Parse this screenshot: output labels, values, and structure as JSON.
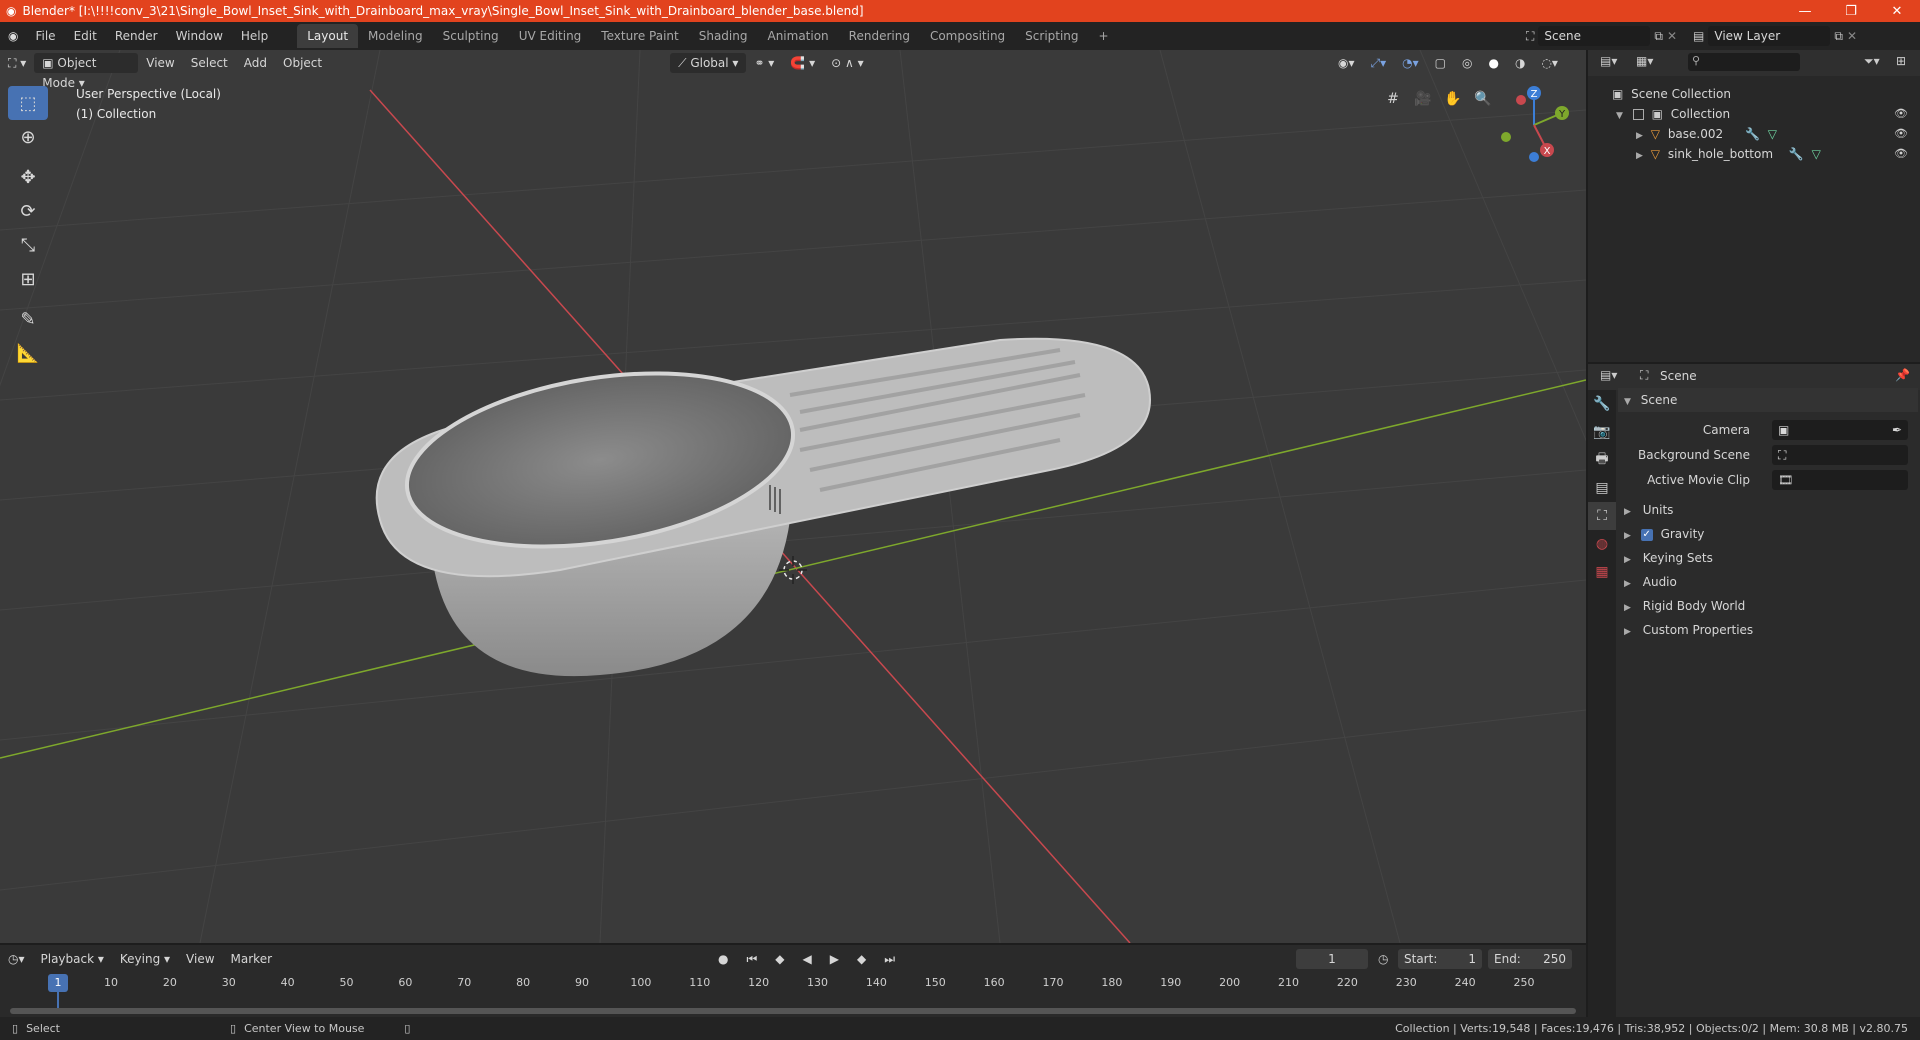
{
  "window": {
    "title": "Blender* [I:\\!!!!conv_3\\21\\Single_Bowl_Inset_Sink_with_Drainboard_max_vray\\Single_Bowl_Inset_Sink_with_Drainboard_blender_base.blend]",
    "minimize": "—",
    "maximize": "❐",
    "close": "✕"
  },
  "menu": [
    "File",
    "Edit",
    "Render",
    "Window",
    "Help"
  ],
  "workspaces": [
    {
      "label": "Layout",
      "active": true
    },
    {
      "label": "Modeling"
    },
    {
      "label": "Sculpting"
    },
    {
      "label": "UV Editing"
    },
    {
      "label": "Texture Paint"
    },
    {
      "label": "Shading"
    },
    {
      "label": "Animation"
    },
    {
      "label": "Rendering"
    },
    {
      "label": "Compositing"
    },
    {
      "label": "Scripting"
    }
  ],
  "add_workspace": "+",
  "scene_field": "Scene",
  "view_layer_field": "View Layer",
  "viewport_header": {
    "mode": "Object Mode",
    "view": "View",
    "select": "Select",
    "add": "Add",
    "object": "Object",
    "orientation": "Global"
  },
  "viewport_info": {
    "perspective": "User Perspective (Local)",
    "collection": "(1) Collection"
  },
  "gizmo": {
    "z": "Z",
    "y": "Y",
    "x": "X"
  },
  "outliner": {
    "search_placeholder": "",
    "root": "Scene Collection",
    "collection": "Collection",
    "objects": [
      "base.002",
      "sink_hole_bottom"
    ]
  },
  "properties": {
    "header": "Scene",
    "panel": "Scene",
    "camera_label": "Camera",
    "background_scene_label": "Background Scene",
    "active_clip_label": "Active Movie Clip",
    "sections": [
      "Units",
      "Gravity",
      "Keying Sets",
      "Audio",
      "Rigid Body World",
      "Custom Properties"
    ]
  },
  "timeline": {
    "playback": "Playback",
    "keying": "Keying",
    "view": "View",
    "marker": "Marker",
    "current_frame": "1",
    "start_label": "Start:",
    "start": "1",
    "end_label": "End:",
    "end": "250",
    "ticks": [
      "1",
      "10",
      "20",
      "30",
      "40",
      "50",
      "60",
      "70",
      "80",
      "90",
      "100",
      "110",
      "120",
      "130",
      "140",
      "150",
      "160",
      "170",
      "180",
      "190",
      "200",
      "210",
      "220",
      "230",
      "240",
      "250"
    ]
  },
  "status": {
    "select": "Select",
    "center_view": "Center View to Mouse",
    "stats": "Collection | Verts:19,548 | Faces:19,476 | Tris:38,952 | Objects:0/2 | Mem: 30.8 MB | v2.80.75"
  },
  "colors": {
    "titlebar": "#e2431e",
    "accent": "#4772b3",
    "x_axis": "#c8484e",
    "y_axis": "#7ea82c",
    "z_axis": "#3c7ed6"
  }
}
